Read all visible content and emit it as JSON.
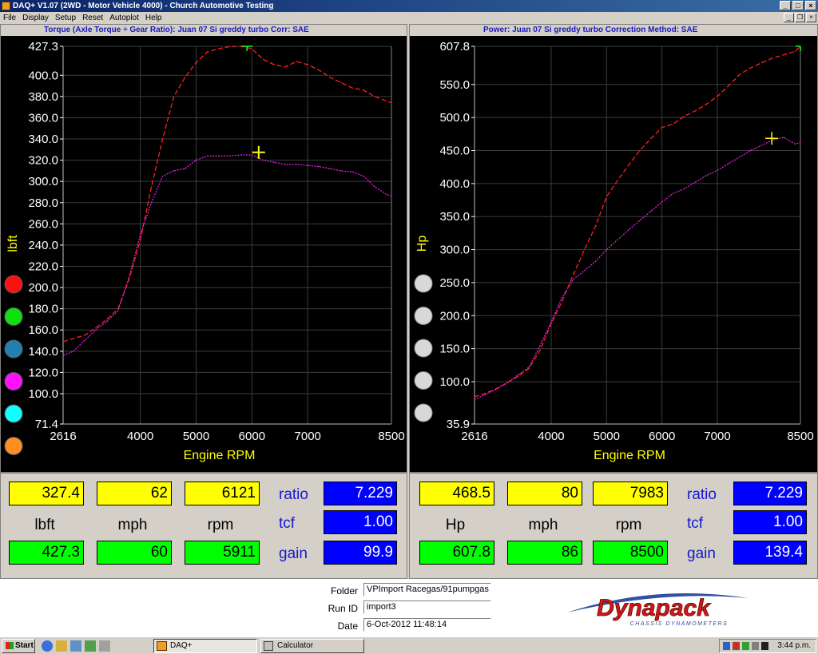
{
  "window": {
    "title": "DAQ+ V1.07 (2WD - Motor Vehicle 4000) - Church Automotive Testing"
  },
  "menu": [
    "File",
    "Display",
    "Setup",
    "Reset",
    "Autoplot",
    "Help"
  ],
  "colors": {
    "torque_curve": "#ff2020",
    "power_curve": "#e020e0",
    "axis_title": "#ffff00",
    "axis_text": "#ffffff",
    "header_text": "#1818c0"
  },
  "left_chart": {
    "header": "Torque (Axle Torque ÷ Gear Ratio): Juan 07 Si greddy turbo        Corr: SAE",
    "ylabel": "lbft",
    "xlabel": "Engine RPM",
    "y_ticks": [
      "427.3",
      "400.0",
      "380.0",
      "360.0",
      "340.0",
      "320.0",
      "300.0",
      "280.0",
      "260.0",
      "240.0",
      "220.0",
      "200.0",
      "180.0",
      "160.0",
      "140.0",
      "120.0",
      "100.0",
      "71.4"
    ],
    "x_ticks": [
      "2616",
      "4000",
      "5000",
      "6000",
      "7000",
      "8500"
    ],
    "swatches": [
      "red",
      "green",
      "steel-blue",
      "magenta",
      "cyan",
      "orange"
    ]
  },
  "right_chart": {
    "header": "Power: Juan 07 Si greddy turbo        Correction Method: SAE",
    "ylabel": "Hp",
    "xlabel": "Engine RPM",
    "y_ticks": [
      "607.8",
      "550.0",
      "500.0",
      "450.0",
      "400.0",
      "350.0",
      "300.0",
      "250.0",
      "200.0",
      "150.0",
      "100.0",
      "35.9"
    ],
    "x_ticks": [
      "2616",
      "4000",
      "5000",
      "6000",
      "7000",
      "8500"
    ],
    "swatches": [
      "grey",
      "grey",
      "grey",
      "grey",
      "grey"
    ]
  },
  "chart_data": [
    {
      "type": "line",
      "title": "Torque (Axle Torque ÷ Gear Ratio): Juan 07 Si greddy turbo",
      "xlabel": "Engine RPM",
      "ylabel": "lbft",
      "xlim": [
        2616,
        8500
      ],
      "ylim": [
        71.4,
        427.3
      ],
      "grid": true,
      "series": [
        {
          "color": "#ff2020",
          "style": "dashed",
          "x": [
            2616,
            2800,
            3000,
            3200,
            3400,
            3600,
            3800,
            4000,
            4200,
            4400,
            4600,
            4800,
            5000,
            5200,
            5400,
            5600,
            5800,
            6000,
            6200,
            6400,
            6600,
            6800,
            7000,
            7200,
            7400,
            7600,
            7800,
            8000,
            8200,
            8400,
            8500
          ],
          "y": [
            149,
            152,
            155,
            162,
            170,
            180,
            208,
            245,
            295,
            340,
            380,
            398,
            412,
            422,
            425,
            427,
            427.3,
            425,
            415,
            410,
            408,
            413,
            410,
            405,
            398,
            393,
            388,
            386,
            380,
            376,
            374
          ]
        },
        {
          "color": "#e020e0",
          "style": "dotted",
          "x": [
            2616,
            2800,
            3000,
            3200,
            3400,
            3600,
            3800,
            4000,
            4200,
            4400,
            4600,
            4800,
            5000,
            5200,
            5400,
            5600,
            5800,
            6000,
            6200,
            6400,
            6600,
            6800,
            7000,
            7200,
            7400,
            7600,
            7800,
            8000,
            8200,
            8400,
            8500
          ],
          "y": [
            136,
            140,
            150,
            160,
            168,
            178,
            210,
            250,
            280,
            305,
            310,
            312,
            320,
            324,
            324,
            324,
            325,
            325,
            320,
            318,
            316,
            316,
            315,
            314,
            312,
            310,
            309,
            305,
            295,
            288,
            286
          ]
        }
      ]
    },
    {
      "type": "line",
      "title": "Power: Juan 07 Si greddy turbo",
      "xlabel": "Engine RPM",
      "ylabel": "Hp",
      "xlim": [
        2616,
        8500
      ],
      "ylim": [
        35.9,
        607.8
      ],
      "grid": true,
      "series": [
        {
          "color": "#ff2020",
          "style": "dashed",
          "x": [
            2616,
            2800,
            3000,
            3200,
            3400,
            3600,
            3800,
            4000,
            4200,
            4400,
            4600,
            4800,
            5000,
            5200,
            5400,
            5600,
            5800,
            6000,
            6200,
            6400,
            6600,
            6800,
            7000,
            7200,
            7400,
            7600,
            7800,
            8000,
            8200,
            8400,
            8500
          ],
          "y": [
            77,
            82,
            89,
            98,
            108,
            120,
            148,
            188,
            222,
            262,
            300,
            335,
            380,
            405,
            428,
            450,
            468,
            485,
            490,
            502,
            510,
            520,
            532,
            548,
            565,
            575,
            583,
            590,
            595,
            600,
            607.8
          ]
        },
        {
          "color": "#e020e0",
          "style": "dotted",
          "x": [
            2616,
            2800,
            3000,
            3200,
            3400,
            3600,
            3800,
            4000,
            4200,
            4400,
            4600,
            4800,
            5000,
            5200,
            5400,
            5600,
            5800,
            6000,
            6200,
            6400,
            6600,
            6800,
            7000,
            7200,
            7400,
            7600,
            7800,
            8000,
            8200,
            8400,
            8500
          ],
          "y": [
            73,
            80,
            88,
            98,
            110,
            122,
            155,
            190,
            228,
            255,
            268,
            282,
            300,
            315,
            330,
            344,
            358,
            372,
            385,
            392,
            402,
            412,
            420,
            430,
            440,
            450,
            458,
            466,
            470,
            460,
            462
          ]
        }
      ]
    }
  ],
  "left_readout": {
    "current": [
      "327.4",
      "62",
      "6121"
    ],
    "units": [
      "lbft",
      "mph",
      "rpm"
    ],
    "peak": [
      "427.3",
      "60",
      "5911"
    ],
    "labels": [
      "ratio",
      "tcf",
      "gain"
    ],
    "values": [
      "7.229",
      "1.00",
      "99.9"
    ]
  },
  "right_readout": {
    "current": [
      "468.5",
      "80",
      "7983"
    ],
    "units": [
      "Hp",
      "mph",
      "rpm"
    ],
    "peak": [
      "607.8",
      "86",
      "8500"
    ],
    "labels": [
      "ratio",
      "tcf",
      "gain"
    ],
    "values": [
      "7.229",
      "1.00",
      "139.4"
    ]
  },
  "info": {
    "folder_label": "Folder",
    "folder": "VPImport Racegas/91pumpgas",
    "runid_label": "Run ID",
    "runid": "import3",
    "date_label": "Date",
    "date": "6-Oct-2012 11:48:14",
    "logo_text": "Dynapack",
    "logo_sub": "CHASSIS DYNAMOMETERS"
  },
  "taskbar": {
    "start": "Start",
    "tasks": [
      "DAQ+",
      "Calculator"
    ],
    "time": "3:44 p.m."
  }
}
